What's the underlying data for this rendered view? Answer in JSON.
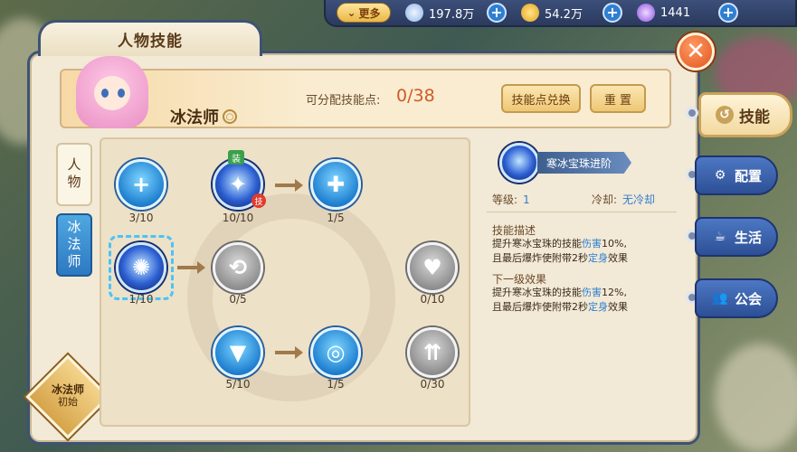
{
  "topbar": {
    "more_label": "更多",
    "resources": [
      {
        "icon": "feather-icon",
        "value": "197.8万",
        "color": "#cfe3ff"
      },
      {
        "icon": "gold-leaf-icon",
        "value": "54.2万",
        "color": "#f3c13a"
      },
      {
        "icon": "crystal-icon",
        "value": "1441",
        "color": "#b98cff"
      }
    ]
  },
  "panel": {
    "title": "人物技能"
  },
  "header": {
    "class_name": "冰法师",
    "points_label": "可分配技能点:",
    "points_value": "0/38",
    "exchange_label": "技能点兑换",
    "reset_label": "重 置"
  },
  "left_tabs": [
    {
      "label": "人物",
      "active": false
    },
    {
      "label": "冰法师",
      "active": true
    }
  ],
  "class_badge": {
    "line1": "冰法师",
    "line2": "初始"
  },
  "tree": {
    "nodes": [
      {
        "id": "n1",
        "level": "3/10",
        "style": "blue",
        "glyph": "+"
      },
      {
        "id": "n2",
        "level": "10/10",
        "style": "dark",
        "glyph": "✦",
        "equip": "装",
        "skill": "技"
      },
      {
        "id": "n3",
        "level": "1/5",
        "style": "blue",
        "glyph": "✚"
      },
      {
        "id": "n4",
        "level": "1/10",
        "style": "dark",
        "glyph": "✺",
        "selected": true
      },
      {
        "id": "n5",
        "level": "0/5",
        "style": "gray",
        "glyph": "⟲"
      },
      {
        "id": "n6",
        "level": "0/10",
        "style": "gray",
        "glyph": "♥"
      },
      {
        "id": "n7",
        "level": "5/10",
        "style": "blue",
        "glyph": "▼"
      },
      {
        "id": "n8",
        "level": "1/5",
        "style": "blue",
        "glyph": "◎"
      },
      {
        "id": "n9",
        "level": "0/30",
        "style": "gray",
        "glyph": "⇈"
      }
    ]
  },
  "detail": {
    "name": "寒冰宝珠进阶",
    "level_label": "等级:",
    "level_value": "1",
    "cooldown_label": "冷却:",
    "cooldown_value": "无冷却",
    "desc_title": "技能描述",
    "desc_a": "提升寒冰宝珠的技能",
    "desc_b": "伤害",
    "desc_c": "10%,",
    "desc_d": "且最后爆炸使附带2秒",
    "desc_e": "定身",
    "desc_f": "效果",
    "next_title": "下一级效果",
    "next_a": "提升寒冰宝珠的技能",
    "next_b": "伤害",
    "next_c": "12%,",
    "next_d": "且最后爆炸使附带2秒",
    "next_e": "定身",
    "next_f": "效果"
  },
  "right_tabs": [
    {
      "label": "技能",
      "icon": "swirl-icon",
      "active": true
    },
    {
      "label": "配置",
      "icon": "gear-icon",
      "active": false
    },
    {
      "label": "生活",
      "icon": "cup-icon",
      "active": false
    },
    {
      "label": "公会",
      "icon": "people-icon",
      "active": false
    }
  ],
  "colors": {
    "panel_border": "#3e5275",
    "accent_orange": "#d05a2a",
    "accent_blue": "#2f7fd0",
    "close": "#e2541f"
  }
}
